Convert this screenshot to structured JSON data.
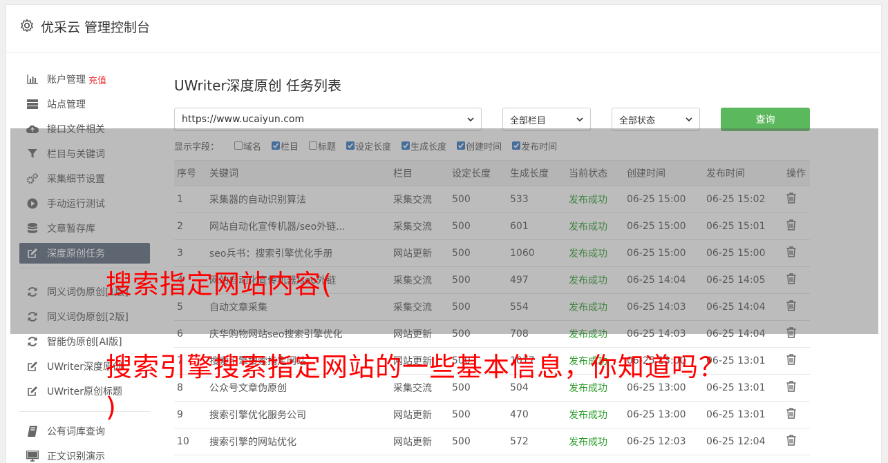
{
  "header": {
    "title": "优采云 管理控制台",
    "icon": "gear-icon"
  },
  "sidebar": {
    "items": [
      {
        "label": "账户管理",
        "tag": "充值",
        "icon": "bar-chart-icon"
      },
      {
        "label": "站点管理",
        "icon": "server-icon"
      },
      {
        "label": "接口文件相关",
        "icon": "cloud-upload-icon"
      },
      {
        "label": "栏目与关键词",
        "icon": "filter-icon"
      },
      {
        "label": "采集细节设置",
        "icon": "gears-icon"
      },
      {
        "label": "手动运行测试",
        "icon": "play-circle-icon"
      },
      {
        "label": "文章暂存库",
        "icon": "database-icon"
      },
      {
        "label": "深度原创任务",
        "icon": "edit-icon"
      },
      {
        "label": "同义词伪原创[1版]",
        "icon": "refresh-icon"
      },
      {
        "label": "同义词伪原创[2版]",
        "icon": "refresh-icon"
      },
      {
        "label": "智能伪原创[AI版]",
        "icon": "refresh-icon"
      },
      {
        "label": "UWriter深度原创",
        "icon": "edit-icon"
      },
      {
        "label": "UWriter原创标题",
        "icon": "edit-icon"
      },
      {
        "label": "公有词库查询",
        "icon": "book-icon"
      },
      {
        "label": "正文识别演示",
        "icon": "monitor-icon"
      }
    ]
  },
  "main": {
    "title": "UWriter深度原创 任务列表",
    "site_select": "https://www.ucaiyun.com",
    "column_select": "全部栏目",
    "status_select": "全部状态",
    "query_button": "查询",
    "fields_label": "显示字段：",
    "fields": [
      {
        "label": "域名",
        "checked": false
      },
      {
        "label": "栏目",
        "checked": true
      },
      {
        "label": "标题",
        "checked": false
      },
      {
        "label": "设定长度",
        "checked": true
      },
      {
        "label": "生成长度",
        "checked": true
      },
      {
        "label": "创建时间",
        "checked": true
      },
      {
        "label": "发布时间",
        "checked": true
      }
    ]
  },
  "table": {
    "headers": [
      "序号",
      "关键词",
      "栏目",
      "设定长度",
      "生成长度",
      "当前状态",
      "创建时间",
      "发布时间",
      "操作"
    ],
    "rows": [
      [
        "1",
        "采集器的自动识别算法",
        "采集交流",
        "500",
        "533",
        "发布成功",
        "06-25 15:00",
        "06-25 15:02"
      ],
      [
        "2",
        "网站自动化宣传机器/seo外链...",
        "采集交流",
        "500",
        "601",
        "发布成功",
        "06-25 15:00",
        "06-25 15:01"
      ],
      [
        "3",
        "seo兵书：搜索引擎优化手册",
        "网站更新",
        "500",
        "1060",
        "发布成功",
        "06-25 15:00",
        "06-25 15:00"
      ],
      [
        "4",
        "网站自动化宣传机器/seo外链",
        "采集交流",
        "500",
        "497",
        "发布成功",
        "06-25 14:04",
        "06-25 14:05"
      ],
      [
        "5",
        "自动文章采集",
        "采集交流",
        "500",
        "554",
        "发布成功",
        "06-25 14:03",
        "06-25 14:04"
      ],
      [
        "6",
        "庆华购物网站seo搜索引擎优化",
        "网站更新",
        "500",
        "708",
        "发布成功",
        "06-25 14:03",
        "06-25 14:04"
      ],
      [
        "7",
        "搜索引擎搜索指定网站",
        "网站更新",
        "500",
        "1017",
        "发布成功",
        "06-25 13:00",
        "06-25 13:01"
      ],
      [
        "8",
        "公众号文章伪原创",
        "采集交流",
        "500",
        "504",
        "发布成功",
        "06-25 13:00",
        "06-25 13:01"
      ],
      [
        "9",
        "搜索引擎优化服务公司",
        "网站更新",
        "500",
        "470",
        "发布成功",
        "06-25 13:00",
        "06-25 13:01"
      ],
      [
        "10",
        "搜索引擎的网站优化",
        "网站更新",
        "500",
        "572",
        "发布成功",
        "06-25 12:03",
        "06-25 12:04"
      ]
    ]
  },
  "watermark": {
    "line1": "搜索指定网站内容(",
    "line2": "搜索引擎搜索指定网站的一些基本信息，你知道吗？",
    "line3": ")"
  }
}
